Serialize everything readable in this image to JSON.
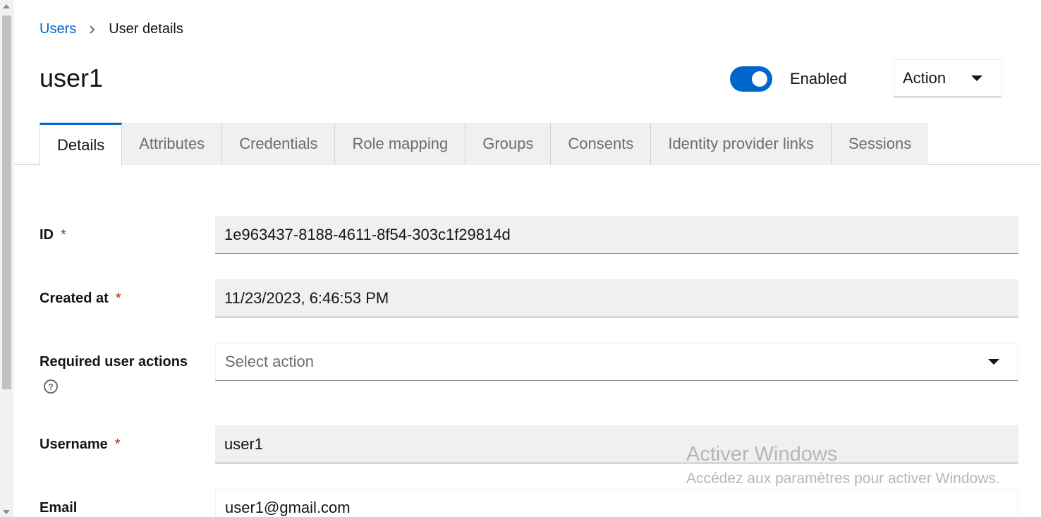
{
  "breadcrumb": {
    "parent": "Users",
    "current": "User details"
  },
  "page": {
    "title": "user1"
  },
  "enabled": {
    "label": "Enabled",
    "on": true
  },
  "action_menu": {
    "label": "Action"
  },
  "tabs": [
    {
      "label": "Details",
      "active": true
    },
    {
      "label": "Attributes"
    },
    {
      "label": "Credentials"
    },
    {
      "label": "Role mapping"
    },
    {
      "label": "Groups"
    },
    {
      "label": "Consents"
    },
    {
      "label": "Identity provider links"
    },
    {
      "label": "Sessions"
    }
  ],
  "form": {
    "id": {
      "label": "ID",
      "required": "*",
      "value": "1e963437-8188-4611-8f54-303c1f29814d"
    },
    "created_at": {
      "label": "Created at",
      "required": "*",
      "value": "11/23/2023, 6:46:53 PM"
    },
    "required_actions": {
      "label": "Required user actions",
      "placeholder": "Select action",
      "help_icon": "?"
    },
    "username": {
      "label": "Username",
      "required": "*",
      "value": "user1"
    },
    "email": {
      "label": "Email",
      "value": "user1@gmail.com"
    }
  },
  "watermark": {
    "title": "Activer Windows",
    "subtitle": "Accédez aux paramètres pour activer Windows."
  },
  "colors": {
    "accent": "#0066cc",
    "required": "#c9190b"
  }
}
